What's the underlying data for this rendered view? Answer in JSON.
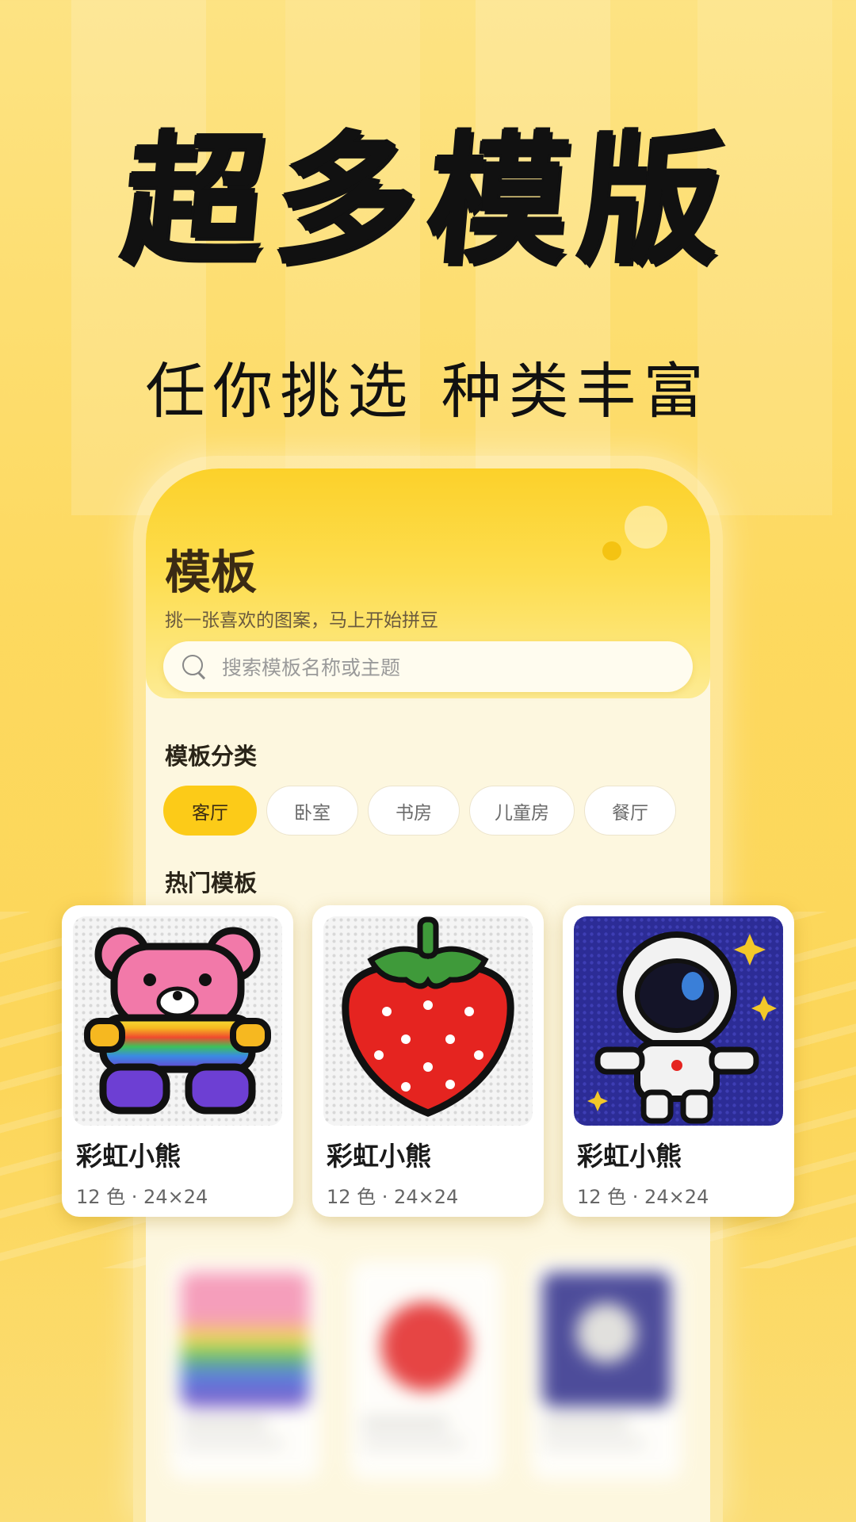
{
  "promo": {
    "headline": "超多模版",
    "subhead": "任你挑选 种类丰富"
  },
  "screen": {
    "title": "模板",
    "subtitle": "挑一张喜欢的图案，马上开始拼豆",
    "search": {
      "placeholder": "搜索模板名称或主题",
      "icon": "search-icon"
    },
    "categories_title": "模板分类",
    "categories": [
      {
        "label": "客厅",
        "active": true
      },
      {
        "label": "卧室",
        "active": false
      },
      {
        "label": "书房",
        "active": false
      },
      {
        "label": "儿童房",
        "active": false
      },
      {
        "label": "餐厅",
        "active": false
      }
    ],
    "hot_title": "热门模板"
  },
  "templates": [
    {
      "name": "彩虹小熊",
      "meta": "12 色 · 24×24",
      "image": "rainbow-bear"
    },
    {
      "name": "彩虹小熊",
      "meta": "12 色 · 24×24",
      "image": "strawberry"
    },
    {
      "name": "彩虹小熊",
      "meta": "12 色 · 24×24",
      "image": "astronaut"
    }
  ],
  "colors": {
    "accent": "#fccb18",
    "header": "#fcd12a",
    "background": "#fdd95f"
  }
}
